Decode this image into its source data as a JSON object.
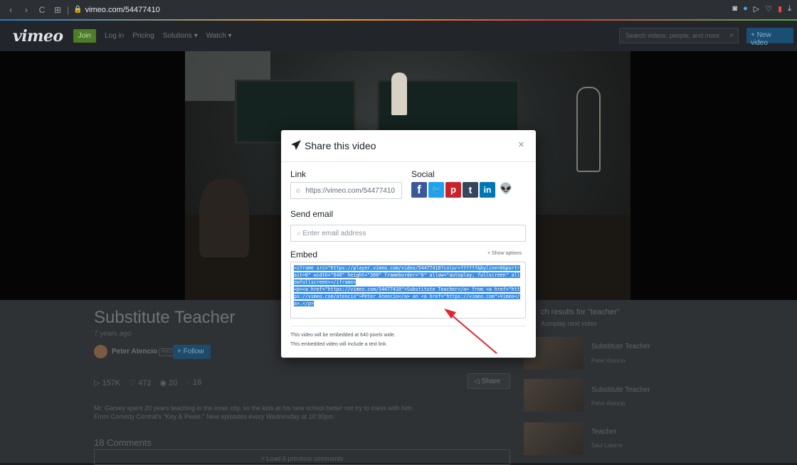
{
  "browser": {
    "url": "vimeo.com/54477410"
  },
  "header": {
    "logo": "vimeo",
    "join": "Join",
    "nav": [
      "Log in",
      "Pricing",
      "Solutions ▾",
      "Watch ▾"
    ],
    "search_placeholder": "Search videos, people, and more",
    "new_video": "+ New video"
  },
  "video": {
    "title": "Substitute Teacher",
    "age": "7 years ago",
    "author": "Peter Atencio",
    "pro_badge": "PRO",
    "follow": "+ Follow",
    "stats": {
      "plays": "157K",
      "likes": "472",
      "collections": "20",
      "comments": "18"
    },
    "share": "Share",
    "description": "Mr. Garvey spent 20 years teaching in the inner city, so the kids at his new school better not try to mess with him. From Comedy Central's \"Key & Peele.\" New episodes every Wednesday at 10:30pm.",
    "comments_heading": "18 Comments",
    "load_comments": "+ Load 6 previous comments"
  },
  "sidebar": {
    "heading": "ch results for \"teacher\"",
    "autoplay": "Autoplay next video",
    "items": [
      {
        "title": "Substitute Teacher",
        "author": "Peter Atencio"
      },
      {
        "title": "Substitute Teacher",
        "author": "Peter Atencio"
      },
      {
        "title": "Teacher",
        "author": "Saul Latorre"
      }
    ]
  },
  "modal": {
    "title": "Share this video",
    "close": "×",
    "link_label": "Link",
    "link_value": "https://vimeo.com/54477410",
    "social_label": "Social",
    "social_icons": {
      "facebook": "f",
      "twitter": "🐦",
      "pinterest": "p",
      "tumblr": "t",
      "linkedin": "in",
      "reddit": "👽"
    },
    "email_label": "Send email",
    "email_placeholder": "Enter email address",
    "embed_label": "Embed",
    "show_options": "+ Show options",
    "embed_code": "<iframe src=\"https://player.vimeo.com/video/54477410?color=ffffff&byline=0&portrait=0\" width=\"640\" height=\"360\" frameborder=\"0\" allow=\"autoplay; fullscreen\" allowfullscreen></iframe>\n<p><a href=\"https://vimeo.com/54477410\">Substitute Teacher</a> from <a href=\"https://vimeo.com/atencio\">Peter Atencio</a> on <a href=\"https://vimeo.com\">Vimeo</a>.</p>",
    "note_1": "This video will be embedded at 640 pixels wide.",
    "note_2": "This embedded video will include a text link."
  },
  "colors": {
    "annotation_arrow": "#e0262f",
    "selection": "#3b8fe3"
  }
}
